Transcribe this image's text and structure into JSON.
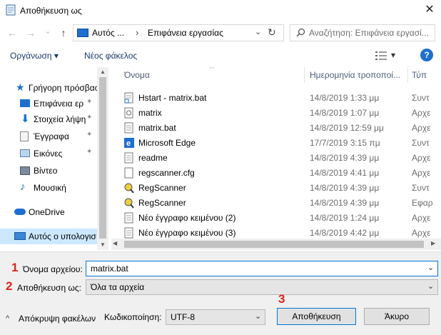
{
  "window": {
    "title": "Αποθήκευση ως",
    "close_glyph": "✕"
  },
  "address": {
    "back_glyph": "←",
    "forward_glyph": "→",
    "recent_glyph": "⌄",
    "up_glyph": "↑",
    "seg1": "Αυτός ...",
    "separator": "›",
    "seg2": "Επιφάνεια εργασίας",
    "dropdown_glyph": "⌄",
    "refresh_glyph": "↻"
  },
  "search": {
    "placeholder": "Αναζήτηση: Επιφάνεια εργασί..."
  },
  "toolbar": {
    "organize_label": "Οργάνωση ▾",
    "new_folder_label": "Νέος φάκελος",
    "view_glyph": "▾",
    "help_glyph": "?"
  },
  "nav": {
    "items": [
      {
        "label": "Γρήγορη πρόσβαση",
        "icon": "star-icon",
        "pinned": false
      },
      {
        "label": "Επιφάνεια ερ",
        "icon": "desktop-icon",
        "pinned": true
      },
      {
        "label": "Στοιχεία λήψη",
        "icon": "download-icon",
        "pinned": true
      },
      {
        "label": "Έγγραφα",
        "icon": "document-icon",
        "pinned": true
      },
      {
        "label": "Εικόνες",
        "icon": "pictures-icon",
        "pinned": true
      },
      {
        "label": "Βίντεο",
        "icon": "video-icon",
        "pinned": false
      },
      {
        "label": "Μουσική",
        "icon": "music-icon",
        "pinned": false
      },
      {
        "label": "OneDrive",
        "icon": "cloud-icon",
        "pinned": false
      },
      {
        "label": "Αυτός ο υπολογισ",
        "icon": "computer-icon",
        "pinned": false
      }
    ],
    "pin_glyph": "📌"
  },
  "filelist": {
    "columns": [
      "Όνομα",
      "Ημερομηνία τροποποί...",
      "Τύπ"
    ],
    "sort_glyph": "^",
    "rows": [
      {
        "name": "Hstart - matrix.bat",
        "date": "14/8/2019 1:33 μμ",
        "type": "Συντ",
        "icon": "shortcut-icon"
      },
      {
        "name": "matrix",
        "date": "14/8/2019 1:07 μμ",
        "type": "Αρχε",
        "icon": "config-file-icon"
      },
      {
        "name": "matrix.bat",
        "date": "14/8/2019 12:59 μμ",
        "type": "Αρχε",
        "icon": "batch-file-icon"
      },
      {
        "name": "Microsoft Edge",
        "date": "17/7/2019 3:15 πμ",
        "type": "Συντ",
        "icon": "edge-icon"
      },
      {
        "name": "readme",
        "date": "14/8/2019 4:39 μμ",
        "type": "Αρχε",
        "icon": "text-file-icon"
      },
      {
        "name": "regscanner.cfg",
        "date": "14/8/2019 4:41 μμ",
        "type": "Αρχε",
        "icon": "file-icon"
      },
      {
        "name": "RegScanner",
        "date": "14/8/2019 4:39 μμ",
        "type": "Συντ",
        "icon": "regscanner-icon"
      },
      {
        "name": "RegScanner",
        "date": "14/8/2019 4:39 μμ",
        "type": "Εφαρ",
        "icon": "regscanner-icon"
      },
      {
        "name": "Νέο έγγραφο κειμένου (2)",
        "date": "14/8/2019 1:24 μμ",
        "type": "Αρχε",
        "icon": "text-file-icon"
      },
      {
        "name": "Νέο έγγραφο κειμένου (3)",
        "date": "14/8/2019 4:42 μμ",
        "type": "Αρχε",
        "icon": "text-file-icon"
      }
    ]
  },
  "form": {
    "filename_label": "Όνομα αρχείου:",
    "filename_value": "matrix.bat",
    "savetype_label": "Αποθήκευση ως:",
    "savetype_value": "Όλα τα αρχεία",
    "hide_folders_label": "Απόκρυψη φακέλων",
    "encoding_label": "Κωδικοποίηση:",
    "encoding_value": "UTF-8",
    "save_label": "Αποθήκευση",
    "cancel_label": "Άκυρο",
    "dropdown_glyph": "⌄",
    "hide_glyph": "^"
  },
  "annotations": {
    "mark1": "1",
    "mark2": "2",
    "mark3": "3",
    "color": "#e02020"
  }
}
